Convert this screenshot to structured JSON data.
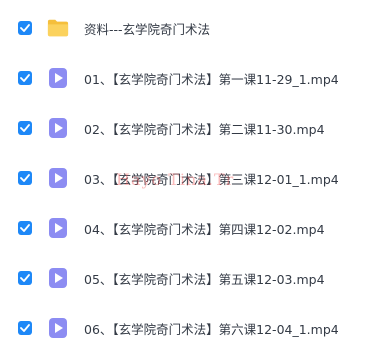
{
  "colors": {
    "checkbox": "#1e88f7",
    "folder": "#f7c84a",
    "video_icon": "#8c8cf2",
    "text": "#333a45",
    "watermark": "#f03c3c"
  },
  "items": [
    {
      "name": "资料---玄学院奇门术法",
      "icon": "folder-icon",
      "checked": true
    },
    {
      "name": "01、【玄学院奇门术法】第一课11-29_1.mp4",
      "icon": "video-file-icon",
      "checked": true
    },
    {
      "name": "02、【玄学院奇门术法】第二课11-30.mp4",
      "icon": "video-file-icon",
      "checked": true
    },
    {
      "name": "03、【玄学院奇门术法】第三课12-01_1.mp4",
      "icon": "video-file-icon",
      "checked": true
    },
    {
      "name": "04、【玄学院奇门术法】第四课12-02.mp4",
      "icon": "video-file-icon",
      "checked": true
    },
    {
      "name": "05、【玄学院奇门术法】第五课12-03.mp4",
      "icon": "video-file-icon",
      "checked": true
    },
    {
      "name": "06、【玄学院奇门术法】第六课12-04_1.mp4",
      "icon": "video-file-icon",
      "checked": true
    }
  ],
  "watermark": "Hayo Tina.Tr"
}
